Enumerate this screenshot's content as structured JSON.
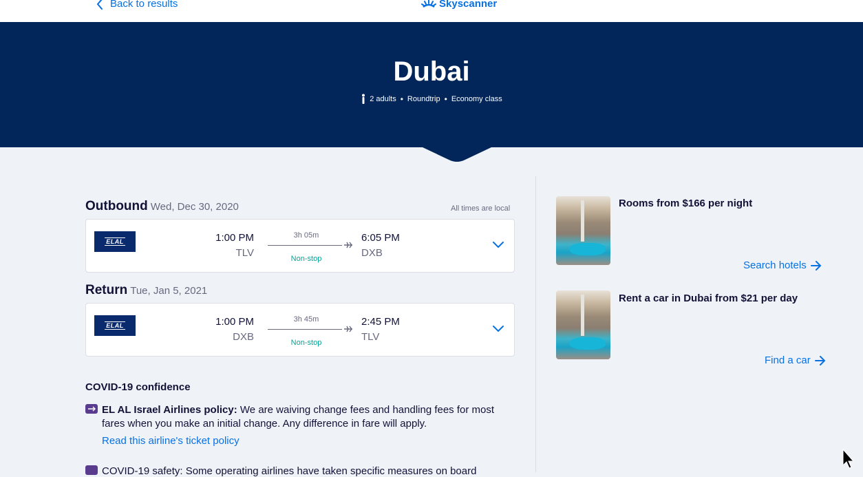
{
  "topbar": {
    "back_label": "Back to results",
    "logo_text": "Skyscanner"
  },
  "hero": {
    "title": "Dubai",
    "passengers": "2 adults",
    "trip_type": "Roundtrip",
    "cabin": "Economy class"
  },
  "note": {
    "times_local": "All times are local"
  },
  "outbound": {
    "label": "Outbound",
    "date": "Wed, Dec 30, 2020",
    "airline_logo_text": "ELAL",
    "dep_time": "1:00 PM",
    "dep_code": "TLV",
    "duration": "3h 05m",
    "stops": "Non-stop",
    "arr_time": "6:05 PM",
    "arr_code": "DXB"
  },
  "return": {
    "label": "Return",
    "date": "Tue, Jan 5, 2021",
    "airline_logo_text": "ELAL",
    "dep_time": "1:00 PM",
    "dep_code": "DXB",
    "duration": "3h 45m",
    "stops": "Non-stop",
    "arr_time": "2:45 PM",
    "arr_code": "TLV"
  },
  "covid": {
    "title": "COVID-19 confidence",
    "policy_bold": "EL AL Israel Airlines policy:",
    "policy_text": " We are waiving change fees and handling fees for most fares when you make an initial change. Any difference in fare will apply.",
    "policy_link": "Read this airline's ticket policy",
    "safety_text": "COVID-19 safety: Some operating airlines have taken specific measures on board"
  },
  "offers": {
    "hotels": {
      "title": "Rooms from $166 per night",
      "link": "Search hotels"
    },
    "cars": {
      "title": "Rent a car in Dubai from $21 per day",
      "link": "Find a car"
    }
  },
  "colors": {
    "accent": "#0770e3",
    "hero_bg": "#02265a",
    "nonstop": "#00a698"
  }
}
